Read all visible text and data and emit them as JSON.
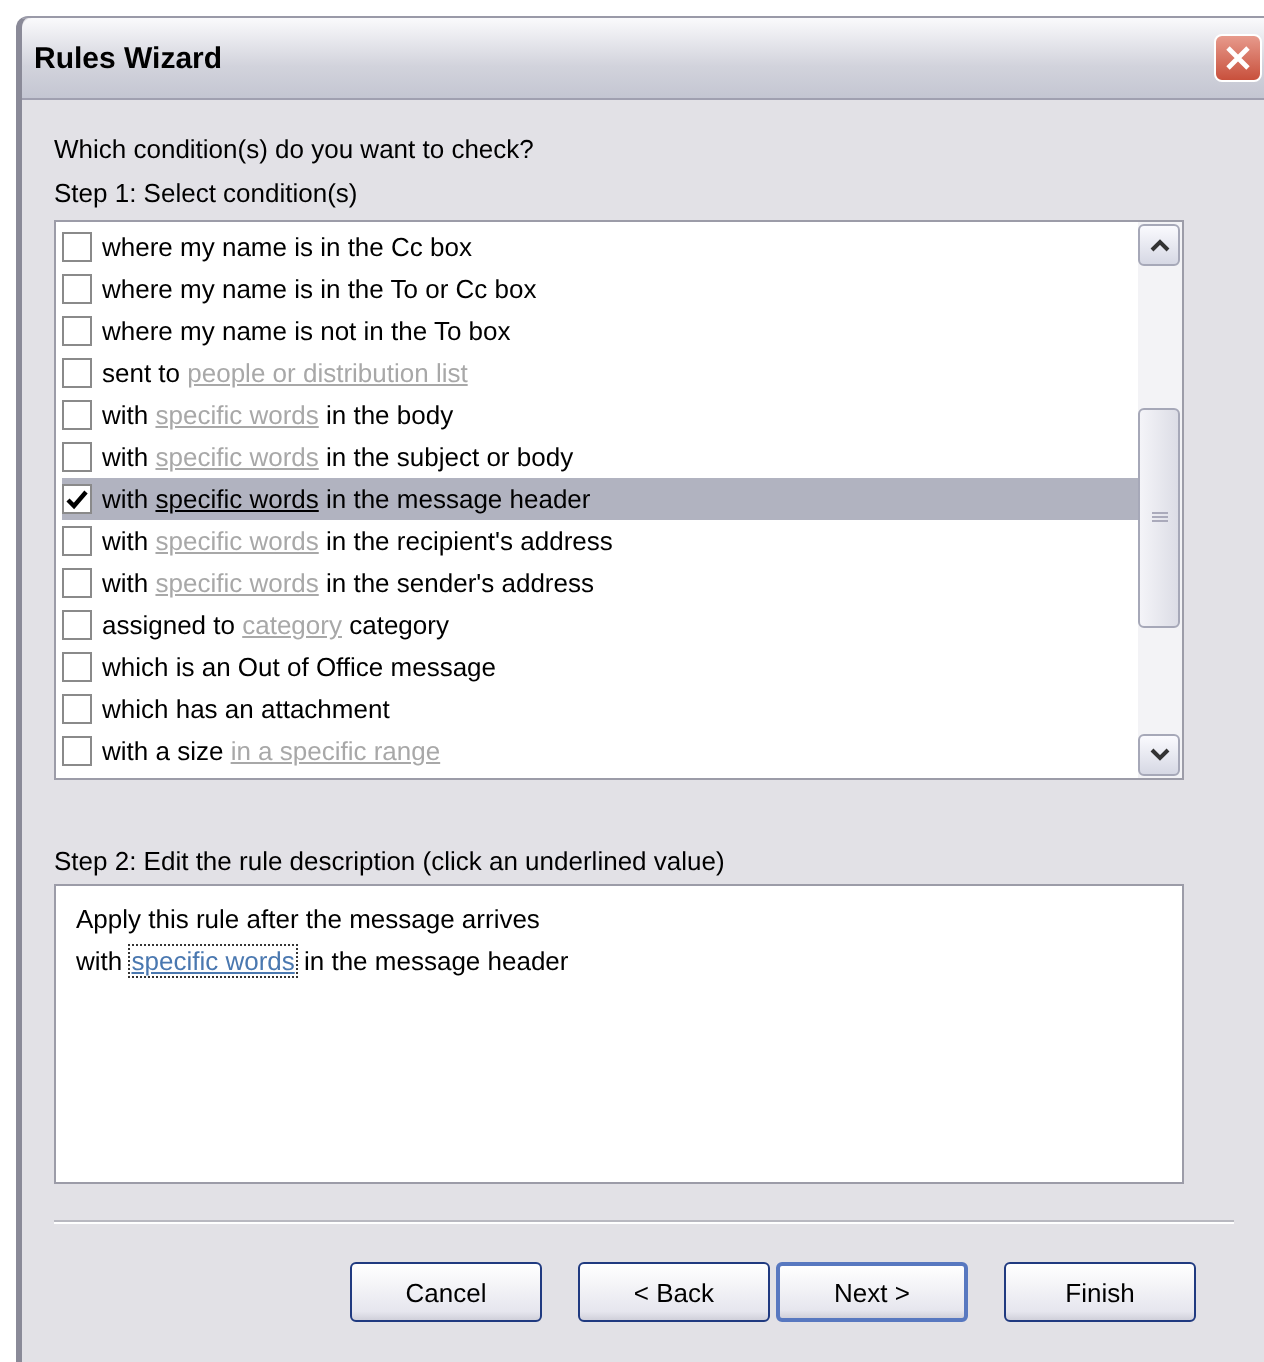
{
  "window": {
    "title": "Rules Wizard"
  },
  "prompt": "Which condition(s) do you want to check?",
  "step1": {
    "label": "Step 1: Select condition(s)",
    "conditions": [
      {
        "checked": false,
        "selected": false,
        "parts": [
          {
            "kind": "plain",
            "text": "where my name is in the Cc box"
          }
        ]
      },
      {
        "checked": false,
        "selected": false,
        "parts": [
          {
            "kind": "plain",
            "text": "where my name is in the To or Cc box"
          }
        ]
      },
      {
        "checked": false,
        "selected": false,
        "parts": [
          {
            "kind": "plain",
            "text": "where my name is not in the To box"
          }
        ]
      },
      {
        "checked": false,
        "selected": false,
        "parts": [
          {
            "kind": "plain",
            "text": "sent to "
          },
          {
            "kind": "link",
            "text": "people or distribution list"
          }
        ]
      },
      {
        "checked": false,
        "selected": false,
        "parts": [
          {
            "kind": "plain",
            "text": "with "
          },
          {
            "kind": "link",
            "text": "specific words"
          },
          {
            "kind": "plain",
            "text": " in the body"
          }
        ]
      },
      {
        "checked": false,
        "selected": false,
        "parts": [
          {
            "kind": "plain",
            "text": "with "
          },
          {
            "kind": "link",
            "text": "specific words"
          },
          {
            "kind": "plain",
            "text": " in the subject or body"
          }
        ]
      },
      {
        "checked": true,
        "selected": true,
        "parts": [
          {
            "kind": "plain",
            "text": "with "
          },
          {
            "kind": "link",
            "text": "specific words"
          },
          {
            "kind": "plain",
            "text": " in the message header"
          }
        ]
      },
      {
        "checked": false,
        "selected": false,
        "parts": [
          {
            "kind": "plain",
            "text": "with "
          },
          {
            "kind": "link",
            "text": "specific words"
          },
          {
            "kind": "plain",
            "text": " in the recipient's address"
          }
        ]
      },
      {
        "checked": false,
        "selected": false,
        "parts": [
          {
            "kind": "plain",
            "text": "with "
          },
          {
            "kind": "link",
            "text": "specific words"
          },
          {
            "kind": "plain",
            "text": " in the sender's address"
          }
        ]
      },
      {
        "checked": false,
        "selected": false,
        "parts": [
          {
            "kind": "plain",
            "text": "assigned to "
          },
          {
            "kind": "link",
            "text": "category"
          },
          {
            "kind": "plain",
            "text": " category"
          }
        ]
      },
      {
        "checked": false,
        "selected": false,
        "parts": [
          {
            "kind": "plain",
            "text": "which is an Out of Office message"
          }
        ]
      },
      {
        "checked": false,
        "selected": false,
        "parts": [
          {
            "kind": "plain",
            "text": "which has an attachment"
          }
        ]
      },
      {
        "checked": false,
        "selected": false,
        "parts": [
          {
            "kind": "plain",
            "text": "with a size "
          },
          {
            "kind": "link",
            "text": "in a specific range"
          }
        ]
      }
    ]
  },
  "step2": {
    "label": "Step 2: Edit the rule description (click an underlined value)",
    "lines": [
      {
        "parts": [
          {
            "kind": "plain",
            "text": "Apply this rule after the message arrives"
          }
        ]
      },
      {
        "parts": [
          {
            "kind": "plain",
            "text": "with "
          },
          {
            "kind": "link",
            "text": "specific words"
          },
          {
            "kind": "plain",
            "text": " in the message header"
          }
        ]
      }
    ]
  },
  "buttons": [
    {
      "label": "Cancel",
      "default": false
    },
    {
      "label": "< Back",
      "default": false
    },
    {
      "label": "Next >",
      "default": true
    },
    {
      "label": "Finish",
      "default": false
    }
  ]
}
